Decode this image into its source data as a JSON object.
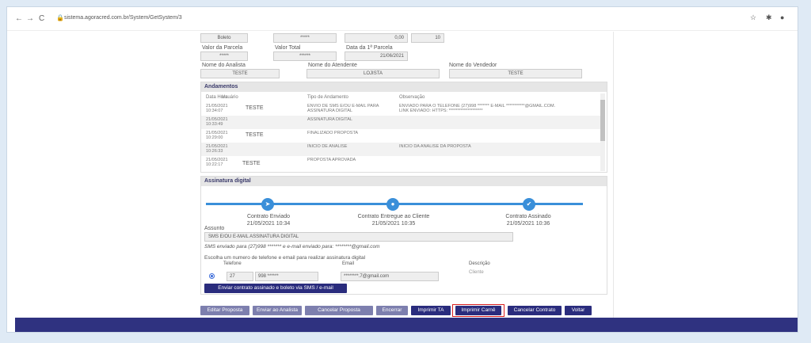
{
  "browser": {
    "url": "sistema.agoracred.com.br/System/GetSystem/3",
    "back_icon": "←",
    "forward_icon": "→",
    "reload_icon": "C",
    "lock_icon": "🔒",
    "star_icon": "☆",
    "ext_icon": "✱",
    "profile_icon": "●"
  },
  "top_fields": {
    "tipo": "Boleto",
    "masked1": "*****",
    "amount": "0,00",
    "count": "10"
  },
  "labels": {
    "valor_parcela": "Valor da Parcela",
    "valor_total": "Valor Total",
    "data_parcela": "Data da 1ª Parcela",
    "nome_analista": "Nome do Analista",
    "nome_atendente": "Nome do Atendente",
    "nome_vendedor": "Nome do Vendedor"
  },
  "values": {
    "valor_parcela": "*****",
    "valor_total": "******",
    "data_parcela": "21/06/2021",
    "analista": "TESTE",
    "atendente": "LOJISTA",
    "vendedor": "TESTE"
  },
  "andamentos": {
    "title": "Andamentos",
    "headers": [
      "Data Hora",
      "Usuário",
      "Tipo de Andamento",
      "Observação"
    ],
    "rows": [
      {
        "date": "21/05/2021",
        "time": "10:34:07",
        "user": "TESTE",
        "tipo1": "ENVIO DE SMS E/OU E-MAIL PARA",
        "tipo2": "ASSINATURA DIGITAL",
        "obs1": "ENVIADO PARA O TELEFONE (27)998 *******   E-MAIL  ***********@GMAIL.COM.",
        "obs2": "LINK ENVIADO: HTTPS: ********************"
      },
      {
        "date": "21/05/2021",
        "time": "10:33:49",
        "user": "",
        "tipo1": "ASSINATURA DIGITAL",
        "tipo2": "",
        "obs1": "",
        "obs2": ""
      },
      {
        "date": "21/05/2021",
        "time": "10:29:00",
        "user": "TESTE",
        "tipo1": "FINALIZADO PROPOSTA",
        "tipo2": "",
        "obs1": "",
        "obs2": ""
      },
      {
        "date": "21/05/2021",
        "time": "10:26:33",
        "user": "",
        "tipo1": "INICIO DE ANALISE",
        "tipo2": "",
        "obs1": "INICIO DA ANALISE DA PROPOSTA",
        "obs2": ""
      },
      {
        "date": "21/05/2021",
        "time": "10:22:17",
        "user": "TESTE",
        "tipo1": "PROPOSTA APROVADA",
        "tipo2": "",
        "obs1": "",
        "obs2": ""
      }
    ]
  },
  "assinatura": {
    "title": "Assinatura digital",
    "steps": [
      {
        "label": "Contrato Enviado",
        "date": "21/05/2021 10:34",
        "icon": "➤"
      },
      {
        "label": "Contrato Entregue ao Cliente",
        "date": "21/05/2021 10:35",
        "icon": "●"
      },
      {
        "label": "Contrato Assinado",
        "date": "21/05/2021 10:36",
        "icon": "✔"
      }
    ],
    "assunto_label": "Assunto",
    "assunto_value": "SMS E/OU E-MAIL ASSINATURA DIGITAL",
    "sms_note": "SMS enviado para (27)998 *******   e e-mail enviado para: ********@gmail.com",
    "choose_note": "Escolha um numero de telefone e email para realizar assinatura digital",
    "col_telefone": "Telefone",
    "col_email": "Email",
    "col_descricao": "Descrição",
    "ddd": "27",
    "phone": "998 ******",
    "email": "********.7@gmail.com",
    "descricao": "Cliente",
    "send_button": "Enviar contrato assinado e boleto via SMS / e-mail"
  },
  "actions": {
    "editar": "Editar Proposta",
    "enviar_analista": "Enviar ao Analista",
    "cancelar_proposta": "Cancelar Proposta",
    "encerrar": "Encerrar",
    "imprimir_ta": "Imprimir TA",
    "imprimir_carne": "Imprimir Carnê",
    "cancelar_contrato": "Cancelar Contrato",
    "voltar": "Voltar"
  }
}
